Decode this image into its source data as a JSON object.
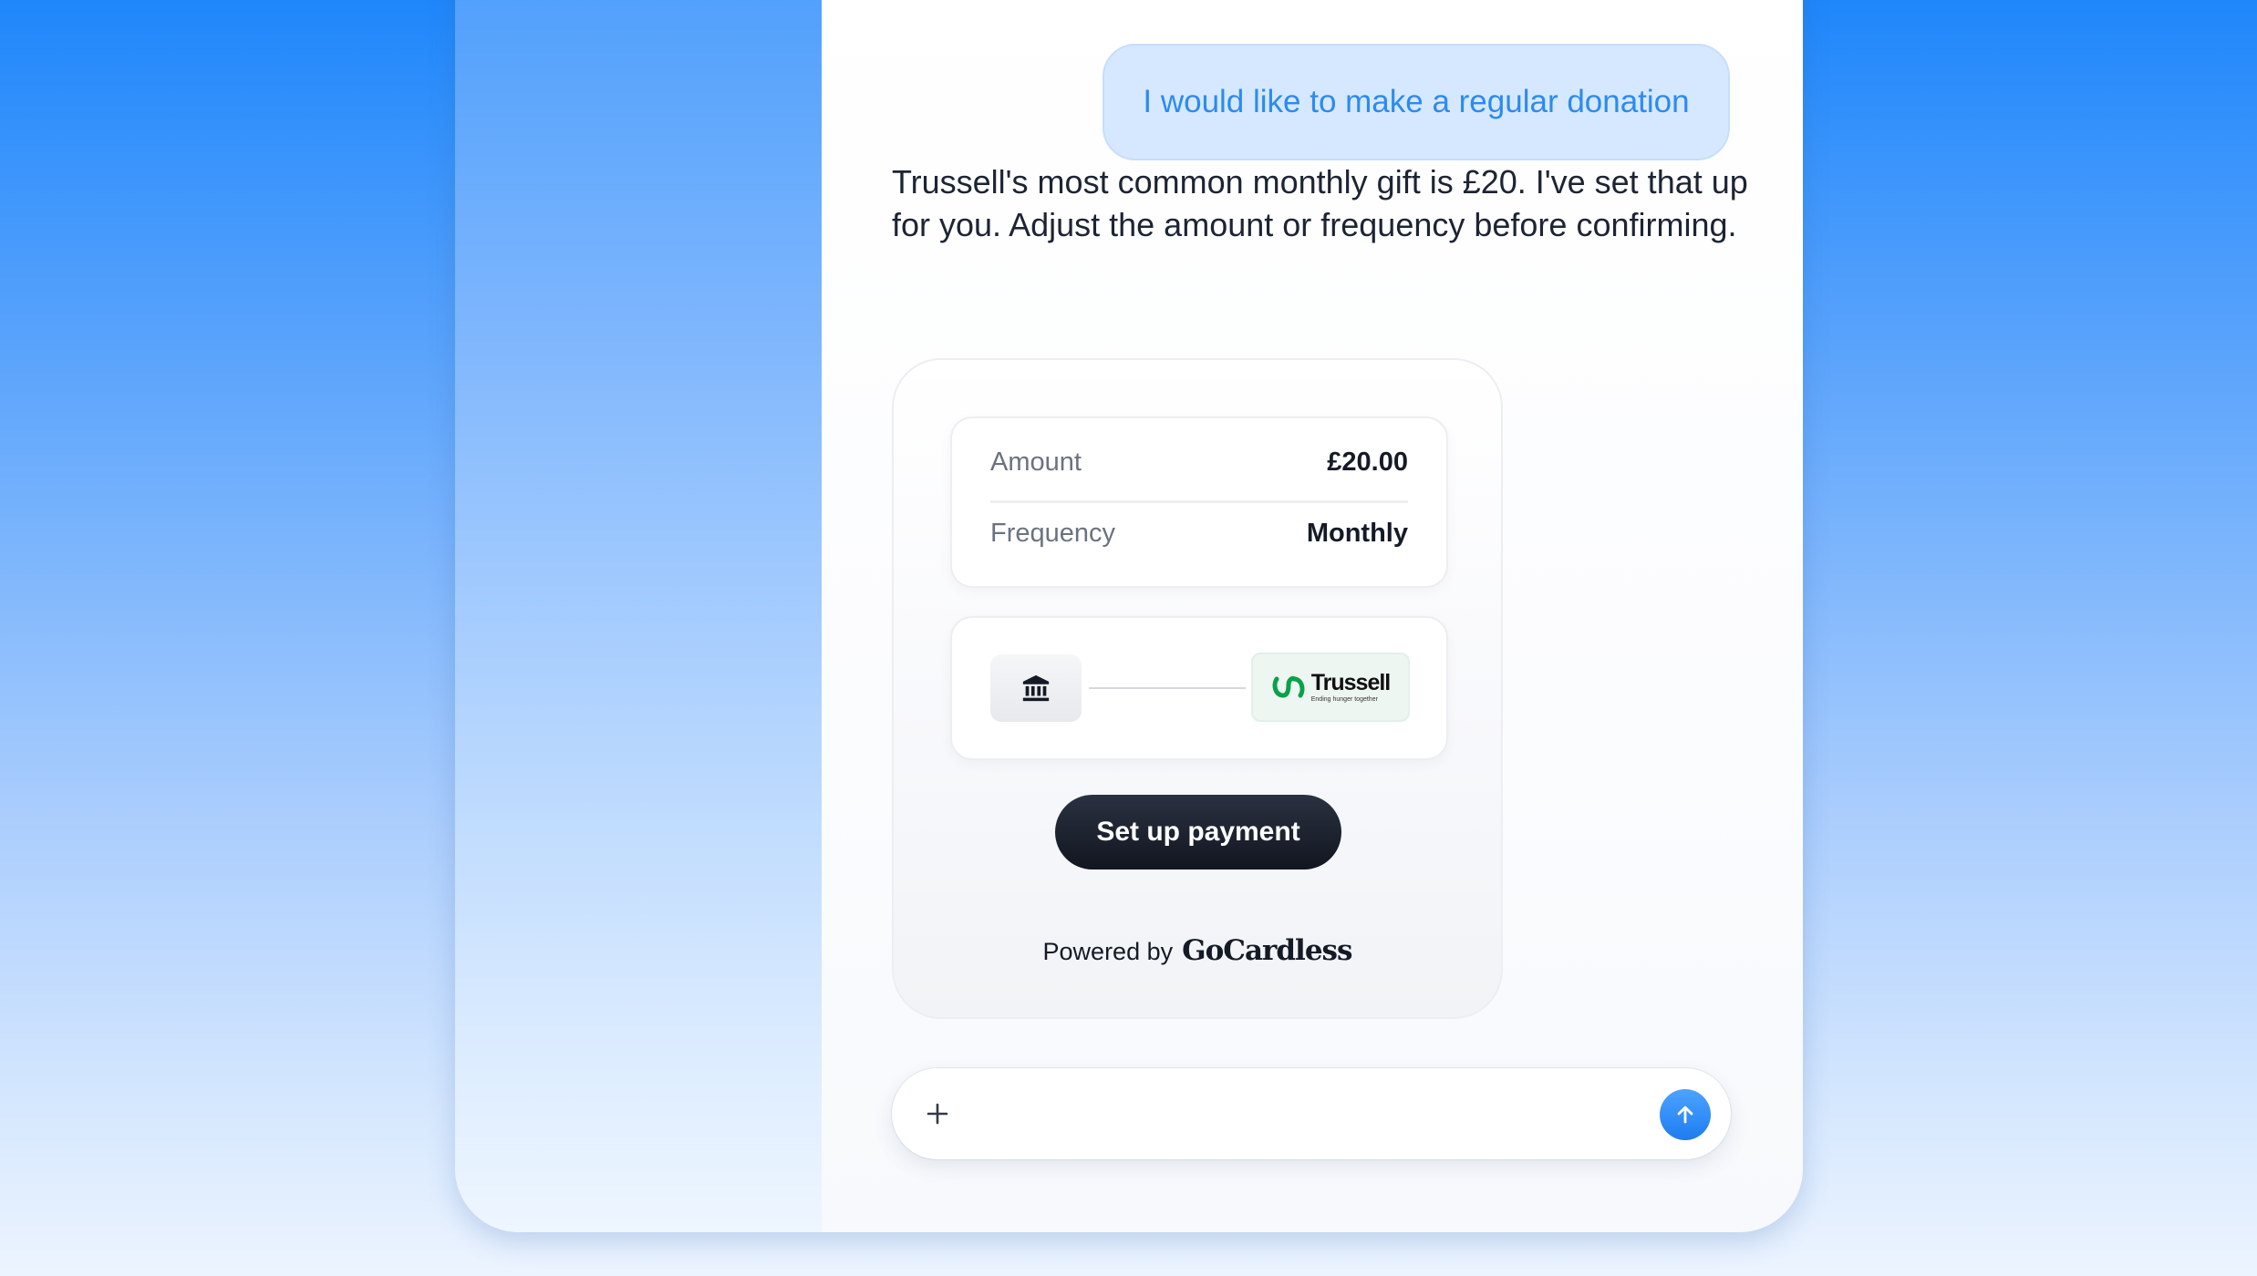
{
  "chat": {
    "user_message": "I would like to make a regular donation",
    "assistant_message": "Trussell's most common monthly gift is £20. I've set that up for you. Adjust the amount or frequency before confirming."
  },
  "payment_card": {
    "amount_label": "Amount",
    "amount_value": "£20.00",
    "frequency_label": "Frequency",
    "frequency_value": "Monthly",
    "source_icon": "bank-icon",
    "recipient_logo": {
      "name": "Trussell",
      "tagline": "Ending hunger together",
      "color": "#0aa14a"
    },
    "cta_label": "Set up payment",
    "powered_by_prefix": "Powered by",
    "powered_by_brand": "GoCardless"
  },
  "composer": {
    "plus_icon": "plus-icon",
    "send_icon": "arrow-up-icon",
    "accent": "#1e7cf0"
  }
}
